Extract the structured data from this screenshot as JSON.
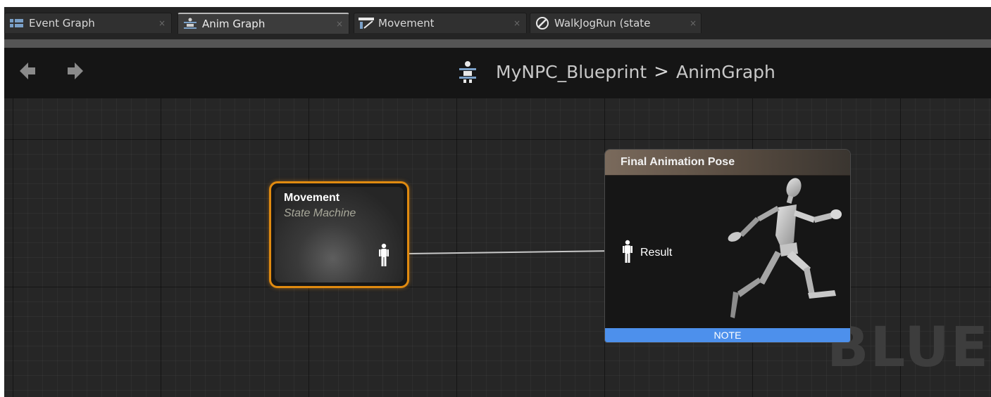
{
  "tabs": [
    {
      "label": "Event Graph",
      "icon": "event-graph-icon",
      "close": "×"
    },
    {
      "label": "Anim Graph",
      "icon": "anim-graph-icon",
      "close": "×"
    },
    {
      "label": "Movement",
      "icon": "state-machine-icon",
      "close": "×"
    },
    {
      "label": "WalkJogRun (state",
      "icon": "state-icon",
      "close": "×"
    }
  ],
  "toolbar": {
    "back_icon": "back-arrow-icon",
    "forward_icon": "forward-arrow-icon"
  },
  "breadcrumb": {
    "icon": "anim-blueprint-icon",
    "blueprint": "MyNPC_Blueprint",
    "separator": ">",
    "graph": "AnimGraph"
  },
  "graph": {
    "watermark": "BLUEPRINT",
    "nodes": {
      "movement": {
        "title": "Movement",
        "subtitle": "State Machine",
        "output_pin_icon": "pose-pin-icon"
      },
      "final_pose": {
        "title": "Final Animation Pose",
        "input_label": "Result",
        "input_pin_icon": "pose-pin-icon",
        "preview_icon": "running-mannequin-icon",
        "footer": "NOTE"
      }
    }
  },
  "colors": {
    "selected_node_border": "#e08a10",
    "note_bar": "#4d90ec",
    "final_header": "#7a6a5c"
  }
}
